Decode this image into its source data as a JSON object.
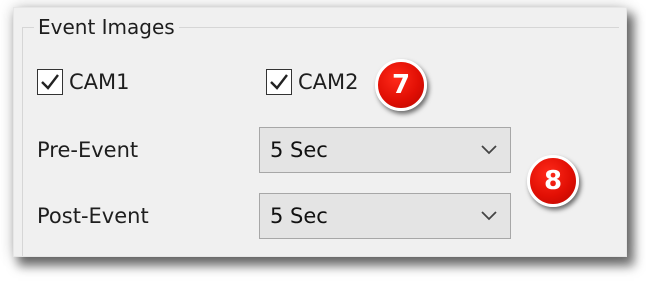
{
  "group": {
    "title": "Event Images"
  },
  "checkboxes": [
    {
      "label": "CAM1",
      "checked": true
    },
    {
      "label": "CAM2",
      "checked": true
    }
  ],
  "fields": {
    "pre_event": {
      "label": "Pre-Event",
      "value": "5 Sec"
    },
    "post_event": {
      "label": "Post-Event",
      "value": "5 Sec"
    }
  },
  "callouts": {
    "badge_7": "7",
    "badge_8": "8",
    "color": "#e10f04"
  }
}
